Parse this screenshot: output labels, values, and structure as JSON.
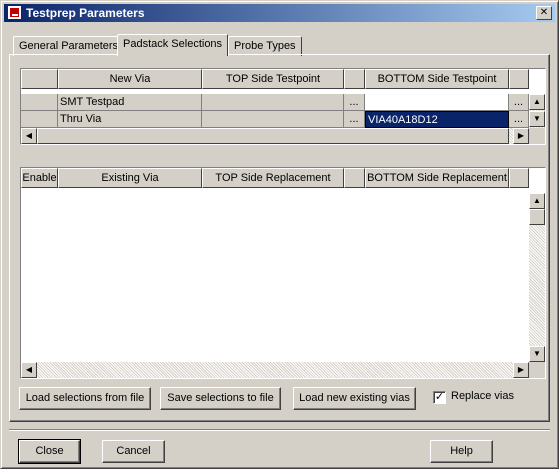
{
  "window": {
    "title": "Testprep Parameters",
    "close_glyph": "✕"
  },
  "tabs": [
    {
      "label": "General Parameters"
    },
    {
      "label": "Padstack Selections"
    },
    {
      "label": "Probe Types"
    }
  ],
  "active_tab": "Padstack Selections",
  "new_via_grid": {
    "headers": [
      "New Via",
      "TOP Side Testpoint",
      "BOTTOM Side Testpoint"
    ],
    "rows": [
      {
        "name": "SMT Testpad",
        "top": "",
        "top_browse": "...",
        "bottom": "",
        "bottom_browse": "..."
      },
      {
        "name": "Thru Via",
        "top": "",
        "top_browse": "...",
        "bottom": "VIA40A18D12",
        "bottom_browse": "..."
      }
    ]
  },
  "replacement_grid": {
    "headers": [
      "Enable",
      "Existing Via",
      "TOP Side Replacement",
      "BOTTOM Side Replacement"
    ],
    "rows": []
  },
  "scroll_glyphs": {
    "up": "▲",
    "down": "▼",
    "left": "◀",
    "right": "▶"
  },
  "actions": {
    "load_selections": "Load selections from file",
    "save_selections": "Save selections to file",
    "load_existing": "Load new existing vias",
    "replace_vias_label": "Replace vias",
    "replace_vias_checked": true,
    "check_glyph": "✓"
  },
  "footer": {
    "close": "Close",
    "cancel": "Cancel",
    "help": "Help"
  },
  "colors": {
    "title_start": "#0a246a",
    "title_end": "#a6caf0",
    "selection": "#0a246a",
    "face": "#d4d0c8"
  }
}
